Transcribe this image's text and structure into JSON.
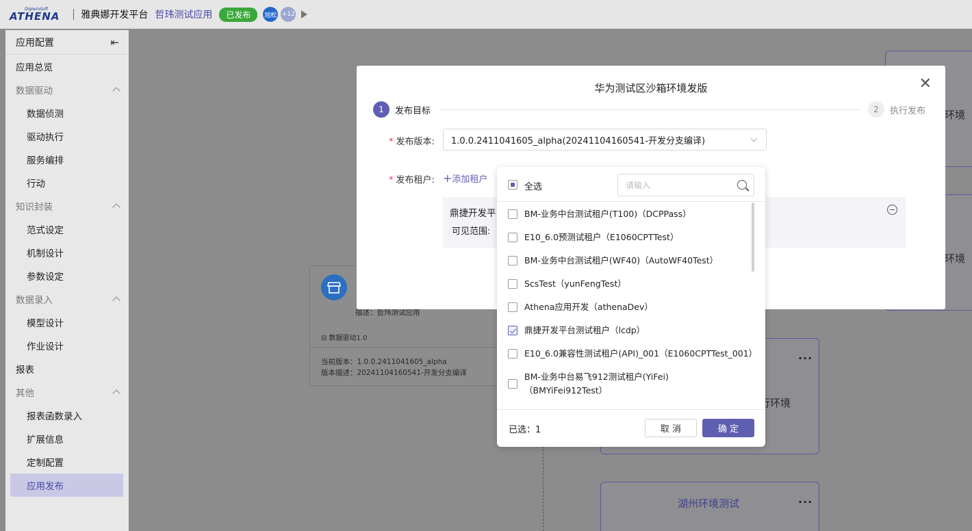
{
  "topbar": {
    "logo_small": "DigiwinSoft",
    "logo_big": "ATHENA",
    "platform": "雅典娜开发平台",
    "app_name": "哲玮测试应用",
    "status_badge": "已发布",
    "avatar_1": "旭松",
    "avatar_more": "+12"
  },
  "sidebar": {
    "title": "应用配置",
    "overview": "应用总览",
    "groups": [
      {
        "label": "数据驱动",
        "items": [
          "数据侦测",
          "驱动执行",
          "服务编排",
          "行动"
        ]
      },
      {
        "label": "知识封装",
        "items": [
          "范式设定",
          "机制设计",
          "参数设定"
        ]
      },
      {
        "label": "数据录入",
        "items": [
          "模型设计",
          "作业设计"
        ]
      }
    ],
    "report": "报表",
    "other_group": {
      "label": "其他",
      "items": [
        "报表函数录入",
        "扩展信息",
        "定制配置",
        "应用发布"
      ]
    }
  },
  "background": {
    "card_desc": "描述：哲玮测试应用",
    "card_tag": "⊟ 数据驱动1.0",
    "card_version": "当前版本：1.0.0.2411041605_alpha",
    "card_version_desc": "版本描述：20241104160541-开发分支编译",
    "env_text_1": "环境",
    "env_text_2": "环境",
    "env_text_3": "行环境",
    "env_card_title": "湖州环境测试",
    "more_dots": "···"
  },
  "modal": {
    "title": "华为测试区沙箱环境发版",
    "step1_num": "1",
    "step1_label": "发布目标",
    "step2_num": "2",
    "step2_label": "执行发布",
    "version_label": "发布版本:",
    "version_value": "1.0.0.2411041605_alpha(20241104160541-开发分支编译)",
    "tenant_label": "发布租户:",
    "add_tenant": "添加租户",
    "tenant_name": "鼎捷开发平",
    "tenant_scope": "可见范围:"
  },
  "dropdown": {
    "select_all": "全选",
    "search_placeholder": "请输入",
    "options": [
      {
        "label": "BM-业务中台测试租户(T100)（DCPPass）",
        "checked": false
      },
      {
        "label": "E10_6.0预测试租户（E1060CPTTest）",
        "checked": false
      },
      {
        "label": "BM-业务中台测试租户(WF40)（AutoWF40Test）",
        "checked": false
      },
      {
        "label": "ScsTest（yunFengTest）",
        "checked": false
      },
      {
        "label": "Athena应用开发（athenaDev）",
        "checked": false
      },
      {
        "label": "鼎捷开发平台测试租户（lcdp）",
        "checked": true
      },
      {
        "label": "E10_6.0兼容性测试租户(API)_001（E1060CPTTest_001）",
        "checked": false
      },
      {
        "label": "BM-业务中台易飞912测试租户(YiFei)",
        "label2": "（BMYiFei912Test）",
        "checked": false
      }
    ],
    "selected_count": "已选：1",
    "cancel": "取 消",
    "confirm": "确 定"
  }
}
